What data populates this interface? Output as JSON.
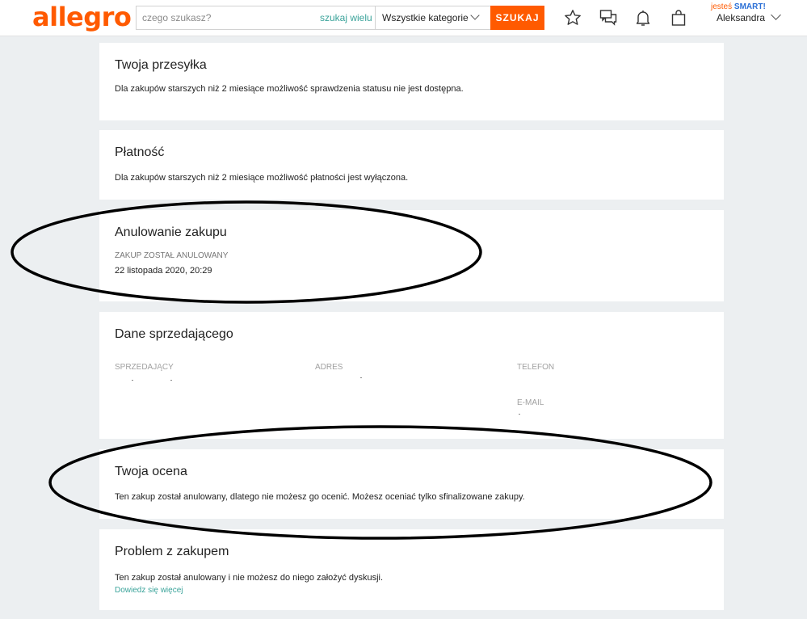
{
  "header": {
    "logo": "allegro",
    "search": {
      "placeholder": "czego szukasz?",
      "search_many": "szukaj wielu"
    },
    "category": "Wszystkie kategorie",
    "search_button": "SZUKAJ",
    "icons": [
      "star-icon",
      "chat-icon",
      "bell-icon",
      "bag-icon"
    ],
    "smart": {
      "prefix": "jesteś",
      "label": "SMART!"
    },
    "user": "Aleksandra",
    "accent_color": "#ff5a00"
  },
  "cards": {
    "shipment": {
      "title": "Twoja przesyłka",
      "text": "Dla zakupów starszych niż 2 miesiące możliwość sprawdzenia statusu nie jest dostępna."
    },
    "payment": {
      "title": "Płatność",
      "text": "Dla zakupów starszych niż 2 miesiące możliwość płatności jest wyłączona."
    },
    "cancellation": {
      "title": "Anulowanie zakupu",
      "status": "ZAKUP ZOSTAŁ ANULOWANY",
      "date": "22 listopada 2020, 20:29"
    },
    "seller": {
      "title": "Dane sprzedającego",
      "seller_label": "SPRZEDAJĄCY",
      "address_label": "ADRES",
      "phone_label": "TELEFON",
      "email_label": "E-MAIL"
    },
    "rating": {
      "title": "Twoja ocena",
      "text": "Ten zakup został anulowany, dlatego nie możesz go ocenić. Możesz oceniać tylko sfinalizowane zakupy."
    },
    "problem": {
      "title": "Problem z zakupem",
      "text": "Ten zakup został anulowany i nie możesz do niego założyć dyskusji.",
      "link": "Dowiedz się więcej"
    }
  }
}
